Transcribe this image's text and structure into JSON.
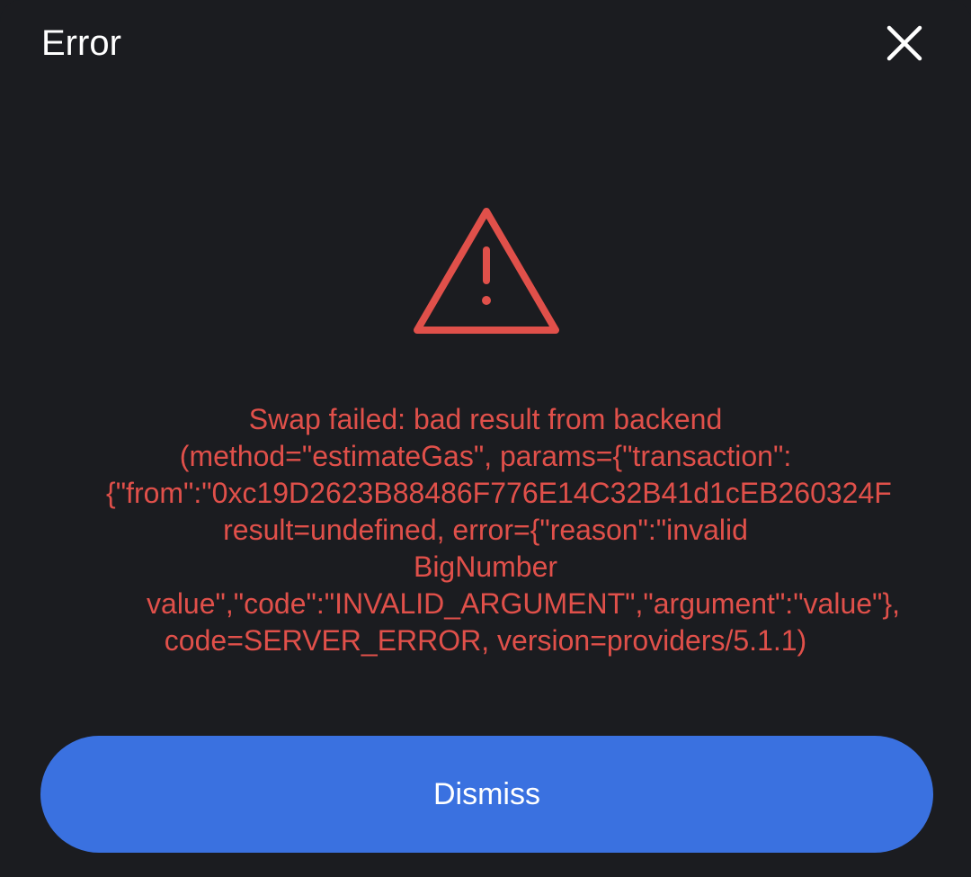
{
  "modal": {
    "title": "Error",
    "close_icon": "close-icon",
    "warning_icon": "warning-triangle-icon",
    "error_lines": [
      "Swap failed: bad result from backend",
      "(method=\"estimateGas\", params={\"transaction\":",
      "{\"from\":\"0xc19D2623B88486F776E14C32B41d1cEB260324F",
      "result=undefined, error={\"reason\":\"invalid",
      "BigNumber",
      "value\",\"code\":\"INVALID_ARGUMENT\",\"argument\":\"value\"},",
      "code=SERVER_ERROR, version=providers/5.1.1)"
    ],
    "dismiss_label": "Dismiss"
  },
  "colors": {
    "background": "#1b1c20",
    "error_red": "#e0504a",
    "button_blue": "#3a71e0",
    "text_white": "#ffffff"
  }
}
